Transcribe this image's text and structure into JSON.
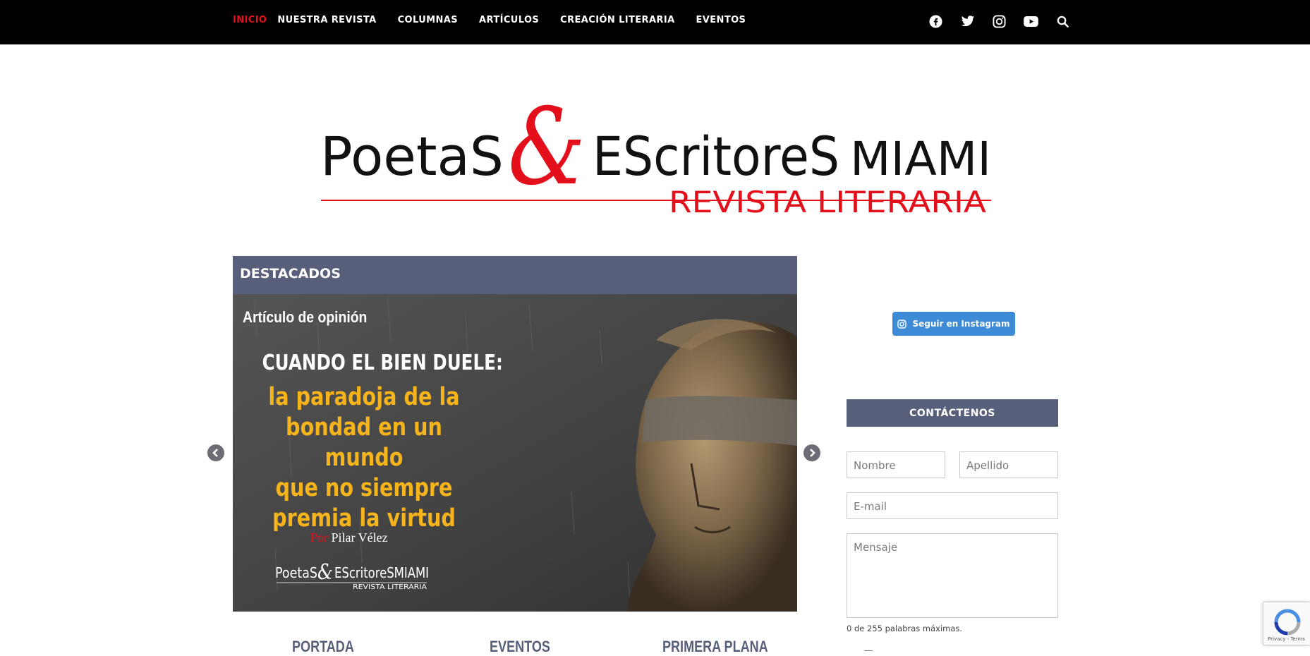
{
  "nav": {
    "items": [
      "INICIO",
      "NUESTRA REVISTA",
      "COLUMNAS",
      "ARTÍCULOS",
      "CREACIÓN LITERARIA",
      "EVENTOS"
    ],
    "active_index": 0,
    "accent": "#e3101c"
  },
  "social": [
    "facebook-icon",
    "twitter-icon",
    "instagram-icon",
    "youtube-icon",
    "search-icon"
  ],
  "logo": {
    "line1_a": "PoetaS",
    "amp": "&",
    "line1_b": "EScritoreS",
    "line1_c": "MIAMI",
    "line2": "REVISTA LITERARIA"
  },
  "featured": {
    "heading": "DESTACADOS",
    "slide": {
      "kicker": "Artículo de opinión",
      "headline": "CUANDO EL BIEN DUELE:",
      "subtitle_lines": [
        "la paradoja de la",
        "bondad en un mundo",
        "que no siempre",
        "premia la virtud"
      ],
      "byline_prefix": "Por",
      "byline_author": "Pilar Vélez",
      "mini_logo_a": "PoetaS",
      "mini_logo_amp": "&",
      "mini_logo_b": "EScritoreSMIAMI",
      "mini_logo_sub": "REVISTA LITERARIA"
    }
  },
  "sections": [
    "PORTADA",
    "EVENTOS",
    "PRIMERA PLANA"
  ],
  "sidebar": {
    "instagram_button": "Seguir en Instagram",
    "contact_heading": "CONTÁCTENOS",
    "form": {
      "nombre_placeholder": "Nombre",
      "apellido_placeholder": "Apellido",
      "email_placeholder": "E-mail",
      "mensaje_placeholder": "Mensaje",
      "counter": "0 de 255 palabras máximas."
    }
  },
  "recaptcha": {
    "terms": "Privacy - Terms"
  },
  "colors": {
    "header_bg": "#000000",
    "section_bar": "#575f7b",
    "headline_yellow": "#f5b41c",
    "instagram_blue": "#3d8ad6"
  }
}
